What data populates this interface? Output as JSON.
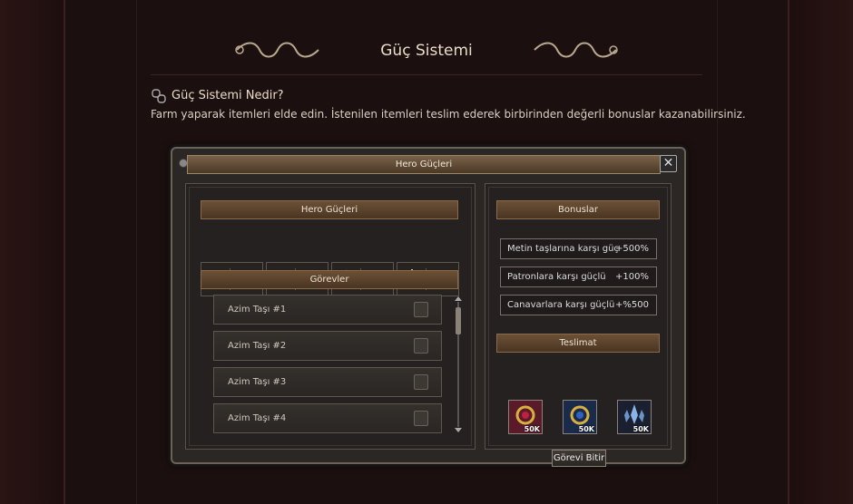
{
  "page": {
    "title": "Güç Sistemi",
    "question_title": "Güç Sistemi Nedir?",
    "description": "Farm yaparak itemleri elde edin. İstenilen itemleri teslim ederek birbirinden değerli bonuslar kazanabilirsiniz."
  },
  "window": {
    "title": "Hero Güçleri",
    "close_label": "✕"
  },
  "left_panel": {
    "powers_header": "Hero Güçleri",
    "powers": [
      {
        "label": "Azim",
        "icon": "horse-icon"
      },
      {
        "label": "İrade",
        "icon": "wing-icon"
      },
      {
        "label": "Karar",
        "icon": "sword-icon"
      },
      {
        "label": "İnanç",
        "icon": "sun-icon"
      }
    ],
    "missions_header": "Görevler",
    "missions": [
      {
        "label": "Azim Taşı #1",
        "icon": "lock-icon"
      },
      {
        "label": "Azim Taşı #2",
        "icon": "lock-icon"
      },
      {
        "label": "Azim Taşı #3",
        "icon": "lock-icon"
      },
      {
        "label": "Azim Taşı #4",
        "icon": "lock-icon"
      }
    ]
  },
  "right_panel": {
    "bonus_header": "Bonuslar",
    "bonuses": [
      {
        "name": "Metin taşlarına karşı güç",
        "value": "+500%"
      },
      {
        "name": "Patronlara karşı güçlü",
        "value": "+100%"
      },
      {
        "name": "Canavarlara karşı güçlü",
        "value": "+%500"
      }
    ],
    "delivery_header": "Teslimat",
    "items": [
      {
        "icon": "red-ring-icon",
        "count": "50K"
      },
      {
        "icon": "blue-ring-icon",
        "count": "50K"
      },
      {
        "icon": "crystal-icon",
        "count": "50K"
      }
    ],
    "finish_button": "Görevi Bitir"
  }
}
